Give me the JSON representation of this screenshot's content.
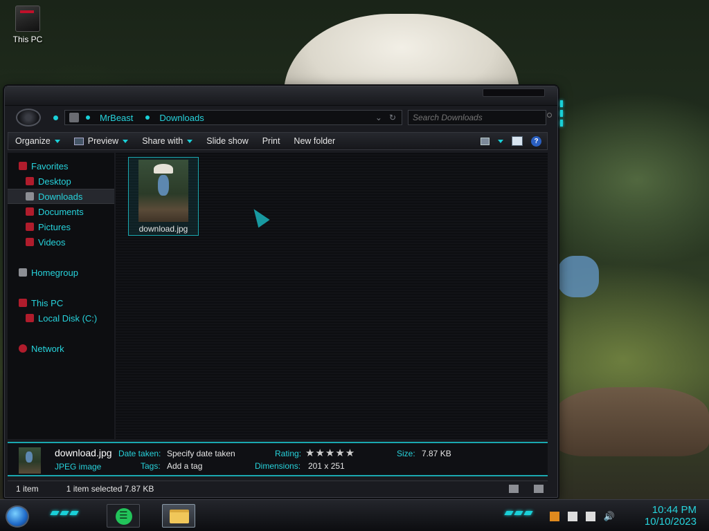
{
  "desktop": {
    "icons": [
      {
        "label": "This PC",
        "icon": "computer-icon"
      }
    ]
  },
  "address_bar": {
    "crumbs": [
      "MrBeast",
      "Downloads"
    ],
    "search_placeholder": "Search Downloads"
  },
  "toolbar": {
    "organize": "Organize",
    "preview": "Preview",
    "share_with": "Share with",
    "slide_show": "Slide show",
    "print": "Print",
    "new_folder": "New folder",
    "help": "?"
  },
  "sidebar": {
    "favorites": "Favorites",
    "desktop": "Desktop",
    "downloads": "Downloads",
    "documents": "Documents",
    "pictures": "Pictures",
    "videos": "Videos",
    "homegroup": "Homegroup",
    "this_pc": "This PC",
    "local_disk": "Local Disk (C:)",
    "network": "Network",
    "selected": "Downloads"
  },
  "files": [
    {
      "name": "download.jpg",
      "selected": true
    }
  ],
  "details": {
    "name": "download.jpg",
    "type": "JPEG image",
    "date_taken_label": "Date taken:",
    "date_taken_value": "Specify date taken",
    "tags_label": "Tags:",
    "tags_value": "Add a tag",
    "rating_label": "Rating:",
    "rating_stars": "★★★★★",
    "dimensions_label": "Dimensions:",
    "dimensions_value": "201 x 251",
    "size_label": "Size:",
    "size_value": "7.87 KB"
  },
  "status": {
    "item_count": "1 item",
    "selection": "1 item selected  7.87 KB"
  },
  "taskbar": {
    "time": "10:44 PM",
    "date": "10/10/2023",
    "apps": [
      "spotify-icon",
      "file-explorer-icon"
    ]
  },
  "colors": {
    "accent": "#1ad0d8",
    "text_accent": "#27d3dc",
    "window_bg": "#1a1b20"
  }
}
